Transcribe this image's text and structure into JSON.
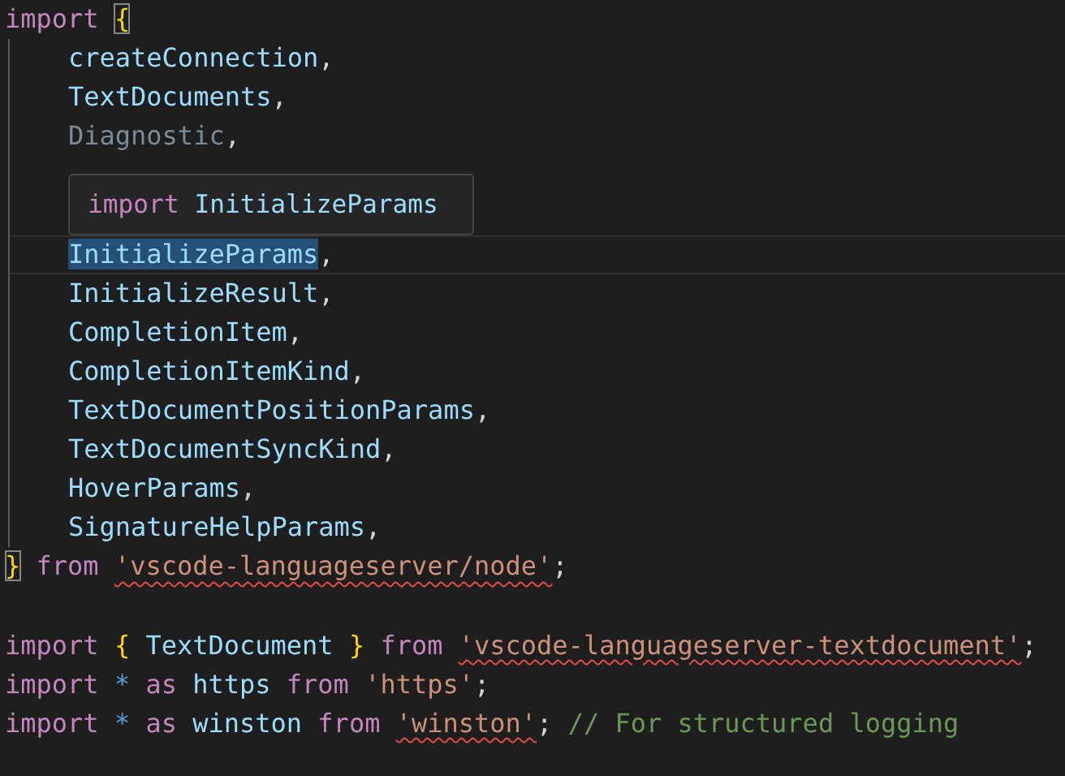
{
  "editor": {
    "lines": [
      {
        "current": false,
        "tokens": [
          {
            "text": "import ",
            "kind": "keyword"
          },
          {
            "text": "{",
            "kind": "bracket-match"
          }
        ],
        "children": [
          {
            "current": false,
            "tokens": [
              {
                "text": "createConnection",
                "kind": "variable"
              },
              {
                "text": ",",
                "kind": "punct"
              }
            ]
          },
          {
            "current": false,
            "tokens": [
              {
                "text": "TextDocuments",
                "kind": "variable"
              },
              {
                "text": ",",
                "kind": "punct"
              }
            ]
          },
          {
            "current": false,
            "tokens": [
              {
                "text": "Diagnostic",
                "kind": "unused"
              },
              {
                "text": ",",
                "kind": "punct"
              }
            ]
          },
          {
            "current": false
          },
          {
            "current": false
          },
          {
            "current": true,
            "tokens": [
              {
                "text": "InitializeParams",
                "kind": "selection"
              },
              {
                "text": ",",
                "kind": "punct"
              }
            ]
          },
          {
            "current": false,
            "tokens": [
              {
                "text": "InitializeResult",
                "kind": "variable"
              },
              {
                "text": ",",
                "kind": "punct"
              }
            ]
          },
          {
            "current": false,
            "tokens": [
              {
                "text": "CompletionItem",
                "kind": "variable"
              },
              {
                "text": ",",
                "kind": "punct"
              }
            ]
          },
          {
            "current": false,
            "tokens": [
              {
                "text": "CompletionItemKind",
                "kind": "variable"
              },
              {
                "text": ",",
                "kind": "punct"
              }
            ]
          },
          {
            "current": false,
            "tokens": [
              {
                "text": "TextDocumentPositionParams",
                "kind": "variable"
              },
              {
                "text": ",",
                "kind": "punct"
              }
            ]
          },
          {
            "current": false,
            "tokens": [
              {
                "text": "TextDocumentSyncKind",
                "kind": "variable"
              },
              {
                "text": ",",
                "kind": "punct"
              }
            ]
          },
          {
            "current": false,
            "tokens": [
              {
                "text": "HoverParams",
                "kind": "variable"
              },
              {
                "text": ",",
                "kind": "punct"
              }
            ]
          },
          {
            "current": false,
            "tokens": [
              {
                "text": "SignatureHelpParams",
                "kind": "variable"
              },
              {
                "text": ",",
                "kind": "punct"
              }
            ]
          }
        ]
      },
      {
        "current": false,
        "tokens": [
          {
            "text": "}",
            "kind": "bracket-match"
          },
          {
            "text": " from ",
            "kind": "keyword"
          },
          {
            "text": "'vscode-languageserver/node'",
            "kind": "string-error"
          },
          {
            "text": ";",
            "kind": "punct"
          }
        ]
      },
      {
        "current": false
      },
      {
        "current": false,
        "tokens": [
          {
            "text": "import ",
            "kind": "keyword"
          },
          {
            "text": "{ ",
            "kind": "brace"
          },
          {
            "text": "TextDocument ",
            "kind": "variable"
          },
          {
            "text": "} ",
            "kind": "brace"
          },
          {
            "text": "from ",
            "kind": "keyword"
          },
          {
            "text": "'vscode-languageserver-textdocument'",
            "kind": "string-error"
          },
          {
            "text": ";",
            "kind": "punct"
          }
        ]
      },
      {
        "current": false,
        "tokens": [
          {
            "text": "import ",
            "kind": "keyword"
          },
          {
            "text": "* ",
            "kind": "operator"
          },
          {
            "text": "as ",
            "kind": "keyword"
          },
          {
            "text": "https ",
            "kind": "variable"
          },
          {
            "text": "from ",
            "kind": "keyword"
          },
          {
            "text": "'https'",
            "kind": "string"
          },
          {
            "text": ";",
            "kind": "punct"
          }
        ]
      },
      {
        "current": false,
        "tokens": [
          {
            "text": "import ",
            "kind": "keyword"
          },
          {
            "text": "* ",
            "kind": "operator"
          },
          {
            "text": "as ",
            "kind": "keyword"
          },
          {
            "text": "winston ",
            "kind": "variable"
          },
          {
            "text": "from ",
            "kind": "keyword"
          },
          {
            "text": "'winston'",
            "kind": "string-error"
          },
          {
            "text": "; ",
            "kind": "punct"
          },
          {
            "text": "// For structured logging",
            "kind": "comment"
          }
        ]
      }
    ]
  },
  "hover": {
    "tokens": [
      {
        "text": "import ",
        "kind": "keyword"
      },
      {
        "text": "InitializeParams",
        "kind": "variable"
      }
    ]
  }
}
